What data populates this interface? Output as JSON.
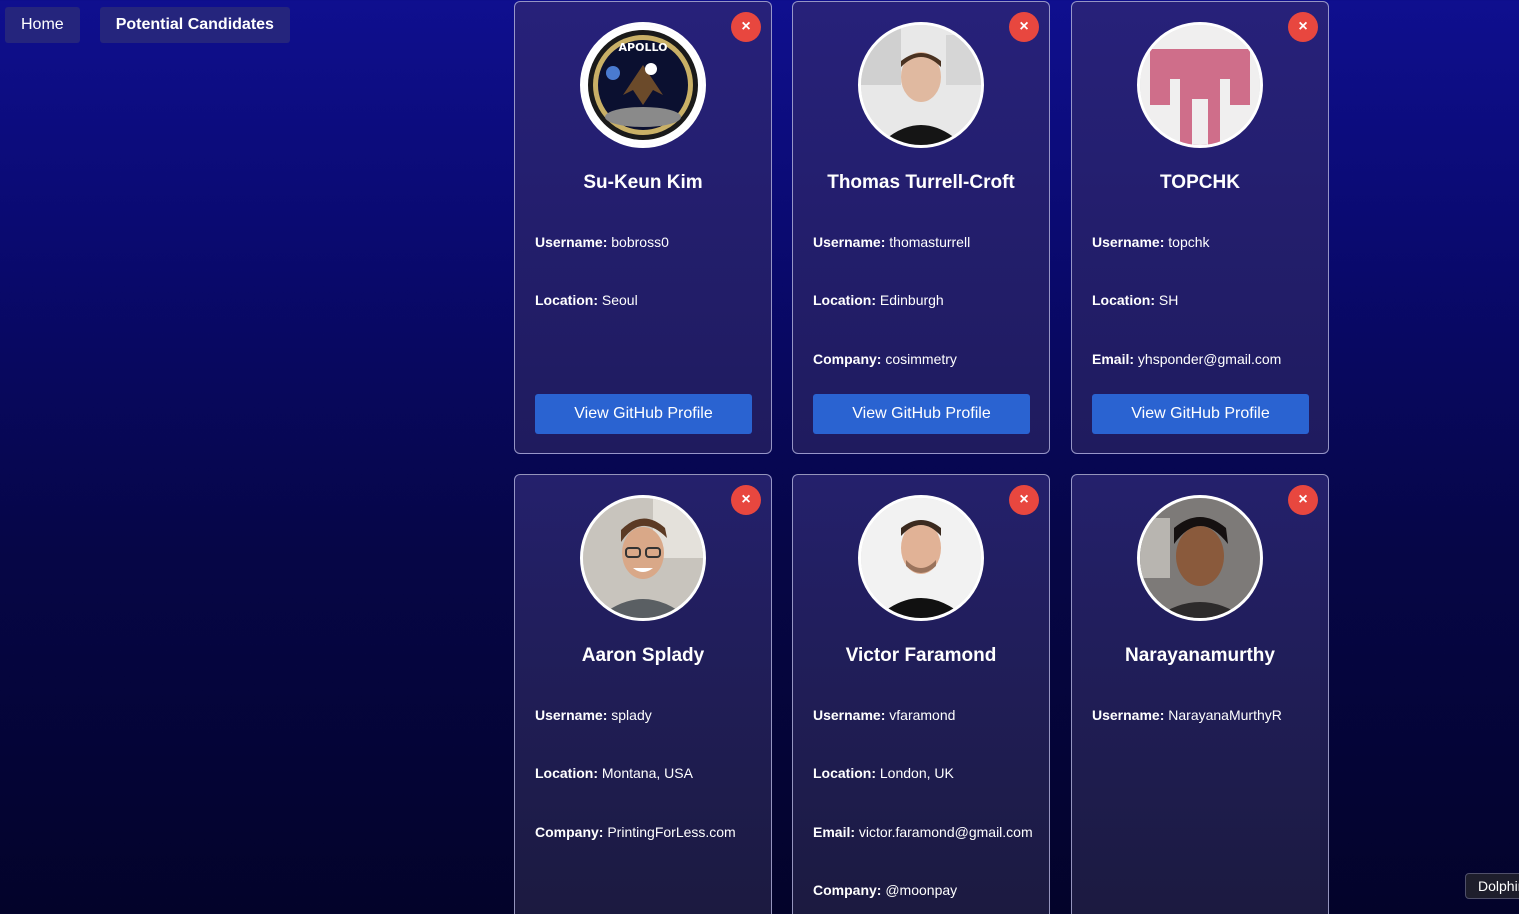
{
  "nav": {
    "home_label": "Home",
    "candidates_label": "Potential Candidates"
  },
  "labels": {
    "username": "Username:",
    "location": "Location:",
    "company": "Company:",
    "email": "Email:",
    "github_button": "View GitHub Profile",
    "close": "×"
  },
  "candidates": [
    {
      "name": "Su-Keun Kim",
      "username": "bobross0",
      "location": "Seoul",
      "avatar_icon": "apollo-11-patch-avatar"
    },
    {
      "name": "Thomas Turrell-Croft",
      "username": "thomasturrell",
      "location": "Edinburgh",
      "company": "cosimmetry",
      "avatar_icon": "person-photo-avatar"
    },
    {
      "name": "TOPCHK",
      "username": "topchk",
      "location": "SH",
      "email": "yhsponder@gmail.com",
      "avatar_icon": "pink-identicon-avatar"
    },
    {
      "name": "Aaron Splady",
      "username": "splady",
      "location": "Montana, USA",
      "company": "PrintingForLess.com",
      "avatar_icon": "person-photo-avatar"
    },
    {
      "name": "Victor Faramond",
      "username": "vfaramond",
      "location": "London, UK",
      "email": "victor.faramond@gmail.com",
      "company": "@moonpay",
      "avatar_icon": "person-photo-avatar"
    },
    {
      "name": "Narayanamurthy",
      "username": "NarayanaMurthyR",
      "avatar_icon": "person-photo-avatar"
    }
  ],
  "tooltip": {
    "text": "Dolphin"
  },
  "colors": {
    "close_button": "#e8473f",
    "github_button": "#2a63d1",
    "nav_button": "#25257d"
  }
}
